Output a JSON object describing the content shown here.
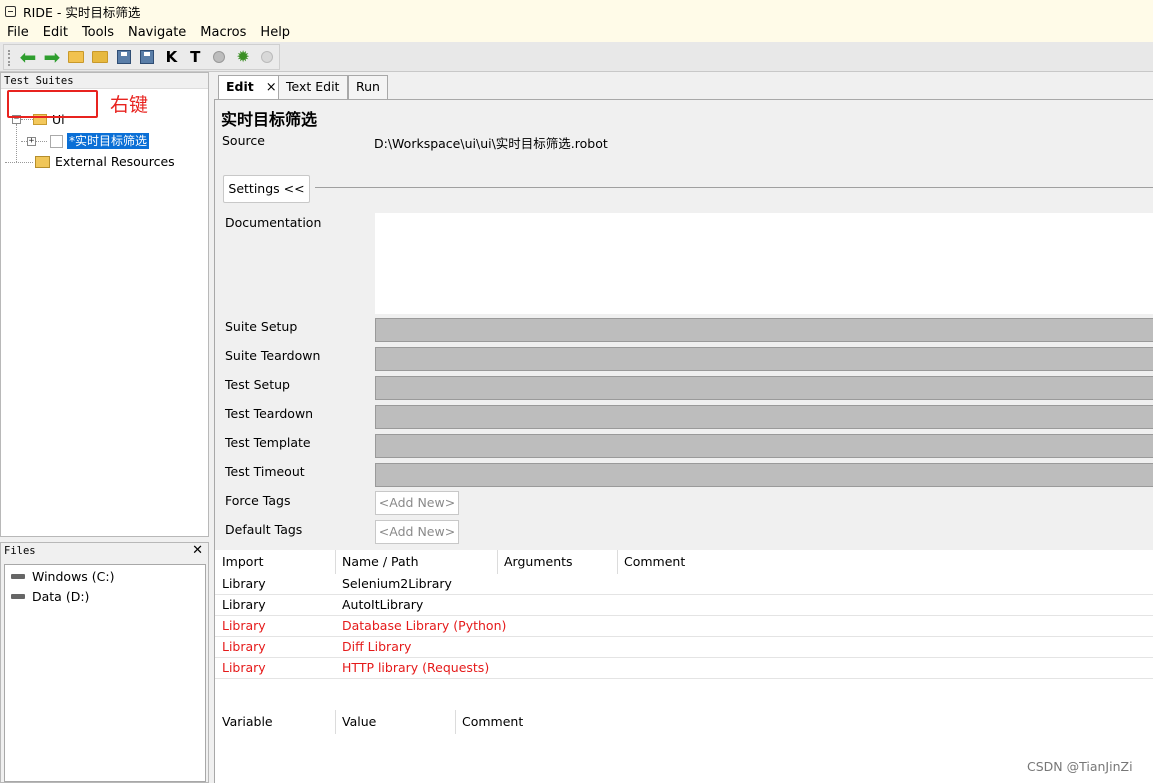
{
  "window": {
    "title": "RIDE - 实时目标筛选"
  },
  "menu": [
    "File",
    "Edit",
    "Tools",
    "Navigate",
    "Macros",
    "Help"
  ],
  "toolbar": {
    "buttons": [
      "back-icon",
      "forward-icon",
      "open-suite-icon",
      "open-directory-icon",
      "save-icon",
      "save-all-icon",
      "search-keywords-icon",
      "search-tests-icon",
      "run-icon",
      "debug-icon",
      "stop-icon"
    ],
    "kw_label": "K",
    "tc_label": "T"
  },
  "suites_panel": {
    "header": "Test Suites",
    "root": {
      "label": "Ui",
      "expander": "−"
    },
    "child": {
      "label": "*实时目标筛选",
      "expander": "+"
    },
    "external": {
      "label": "External Resources"
    },
    "annotation": "右键"
  },
  "files_panel": {
    "header": "Files",
    "close": "✕",
    "drives": [
      "Windows (C:)",
      "Data (D:)"
    ]
  },
  "tabs": [
    {
      "label": "Edit",
      "active": true,
      "close": "×"
    },
    {
      "label": "Text Edit",
      "active": false
    },
    {
      "label": "Run",
      "active": false
    }
  ],
  "editor": {
    "suite_name": "实时目标筛选",
    "source_label": "Source",
    "source_value": "D:\\Workspace\\ui\\ui\\实时目标筛选.robot",
    "settings_button": "Settings <<",
    "documentation_label": "Documentation",
    "fields": [
      "Suite Setup",
      "Suite Teardown",
      "Test Setup",
      "Test Teardown",
      "Test Template",
      "Test Timeout"
    ],
    "force_tags_label": "Force Tags",
    "default_tags_label": "Default Tags",
    "add_new": "<Add New>"
  },
  "imports": {
    "headers": [
      "Import",
      "Name / Path",
      "Arguments",
      "Comment"
    ],
    "rows": [
      {
        "import": "Library",
        "name": "Selenium2Library",
        "error": false
      },
      {
        "import": "Library",
        "name": "AutoItLibrary",
        "error": false
      },
      {
        "import": "Library",
        "name": "Database Library (Python)",
        "error": true
      },
      {
        "import": "Library",
        "name": "Diff Library",
        "error": true
      },
      {
        "import": "Library",
        "name": "HTTP library (Requests)",
        "error": true
      }
    ]
  },
  "variables": {
    "headers": [
      "Variable",
      "Value",
      "Comment"
    ]
  },
  "watermark": "CSDN @TianJinZi",
  "colors": {
    "selection": "#0a6fd6",
    "error_text": "#e51a1a",
    "annotation": "#e8231f"
  }
}
